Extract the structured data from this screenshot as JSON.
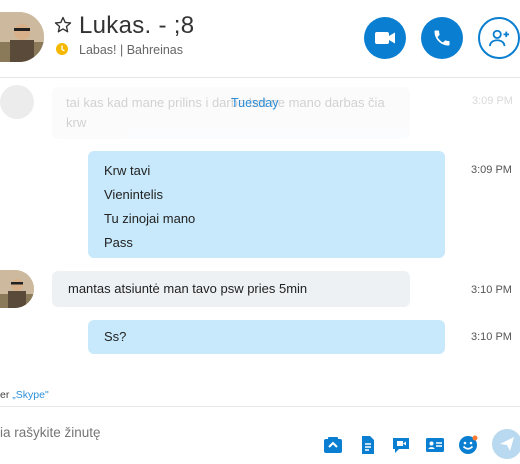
{
  "header": {
    "title": "Lukas. - ;8",
    "mood": "Labas! | Bahreinas"
  },
  "conversation": {
    "faded_message": "tai kas kad mane prilins i darba bet ne mano darbas čia krw",
    "faded_time": "3:09 PM",
    "day_divider": "Tuesday",
    "messages": [
      {
        "direction": "outgoing",
        "lines": [
          "Krw tavi",
          "Vienintelis",
          "Tu zinojai mano",
          "Pass"
        ],
        "time": "3:09 PM"
      },
      {
        "direction": "incoming",
        "text": "mantas atsiuntė man tavo psw pries 5min",
        "time": "3:10 PM"
      },
      {
        "direction": "outgoing",
        "text": "Ss?",
        "time": "3:10 PM"
      }
    ]
  },
  "notice": {
    "prefix": "er ",
    "link": "„Skype\""
  },
  "compose": {
    "placeholder": "ia rašykite žinutę"
  },
  "icons": {
    "header": [
      "star-icon",
      "away-clock-icon",
      "video-call-icon",
      "audio-call-icon",
      "add-people-icon"
    ],
    "compose": [
      "media-icon",
      "file-icon",
      "video-message-icon",
      "contact-card-icon",
      "emoji-icon",
      "send-icon"
    ]
  },
  "colors": {
    "accent": "#0a7fd1",
    "outgoing_bubble": "#c7e9fb",
    "incoming_bubble": "#eef1f4",
    "away": "#f5b800"
  }
}
